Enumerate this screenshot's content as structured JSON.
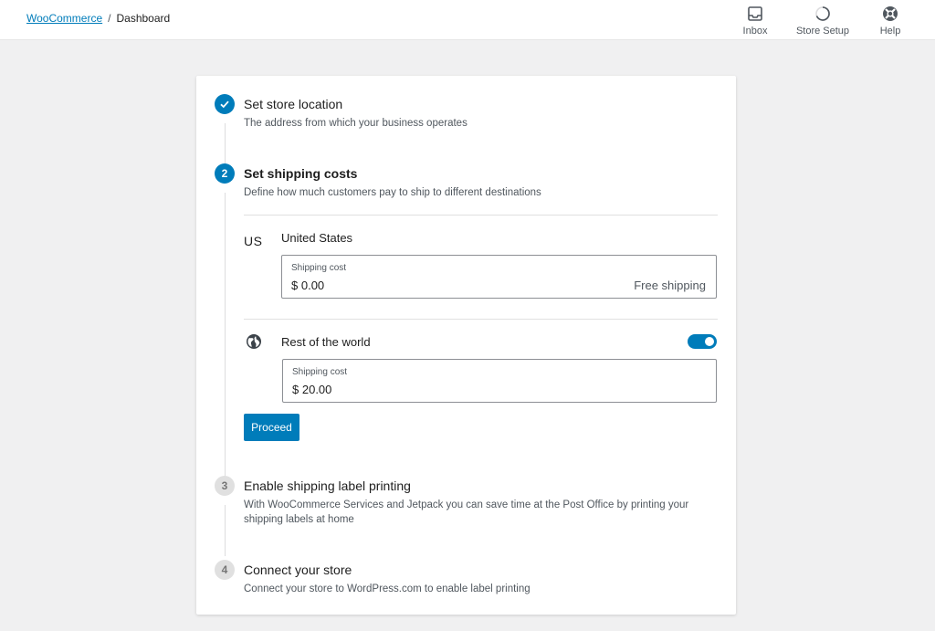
{
  "breadcrumb": {
    "root_link": "WooCommerce",
    "separator": "/",
    "current": "Dashboard"
  },
  "top_actions": [
    {
      "label": "Inbox",
      "icon": "inbox-icon"
    },
    {
      "label": "Store Setup",
      "icon": "progress-circle-icon"
    },
    {
      "label": "Help",
      "icon": "help-lifebuoy-icon"
    }
  ],
  "steps": [
    {
      "number": "1",
      "state": "completed",
      "title": "Set store location",
      "description": "The address from which your business operates"
    },
    {
      "number": "2",
      "state": "active",
      "title": "Set shipping costs",
      "description": "Define how much customers pay to ship to different destinations"
    },
    {
      "number": "3",
      "state": "pending",
      "title": "Enable shipping label printing",
      "description": "With WooCommerce Services and Jetpack you can save time at the Post Office by printing your shipping labels at home"
    },
    {
      "number": "4",
      "state": "pending",
      "title": "Connect your store",
      "description": "Connect your store to WordPress.com to enable label printing"
    }
  ],
  "zones": {
    "us": {
      "code": "US",
      "name": "United States",
      "field_label": "Shipping cost",
      "currency": "$",
      "value": "0.00",
      "suffix": "Free shipping"
    },
    "rest_of_world": {
      "name": "Rest of the world",
      "icon": "globe-icon",
      "enabled": true,
      "field_label": "Shipping cost",
      "currency": "$",
      "value": "20.00"
    }
  },
  "proceed_button": "Proceed",
  "colors": {
    "accent": "#007cba",
    "background": "#f0f0f1",
    "pending_badge": "#e0e0e0"
  }
}
